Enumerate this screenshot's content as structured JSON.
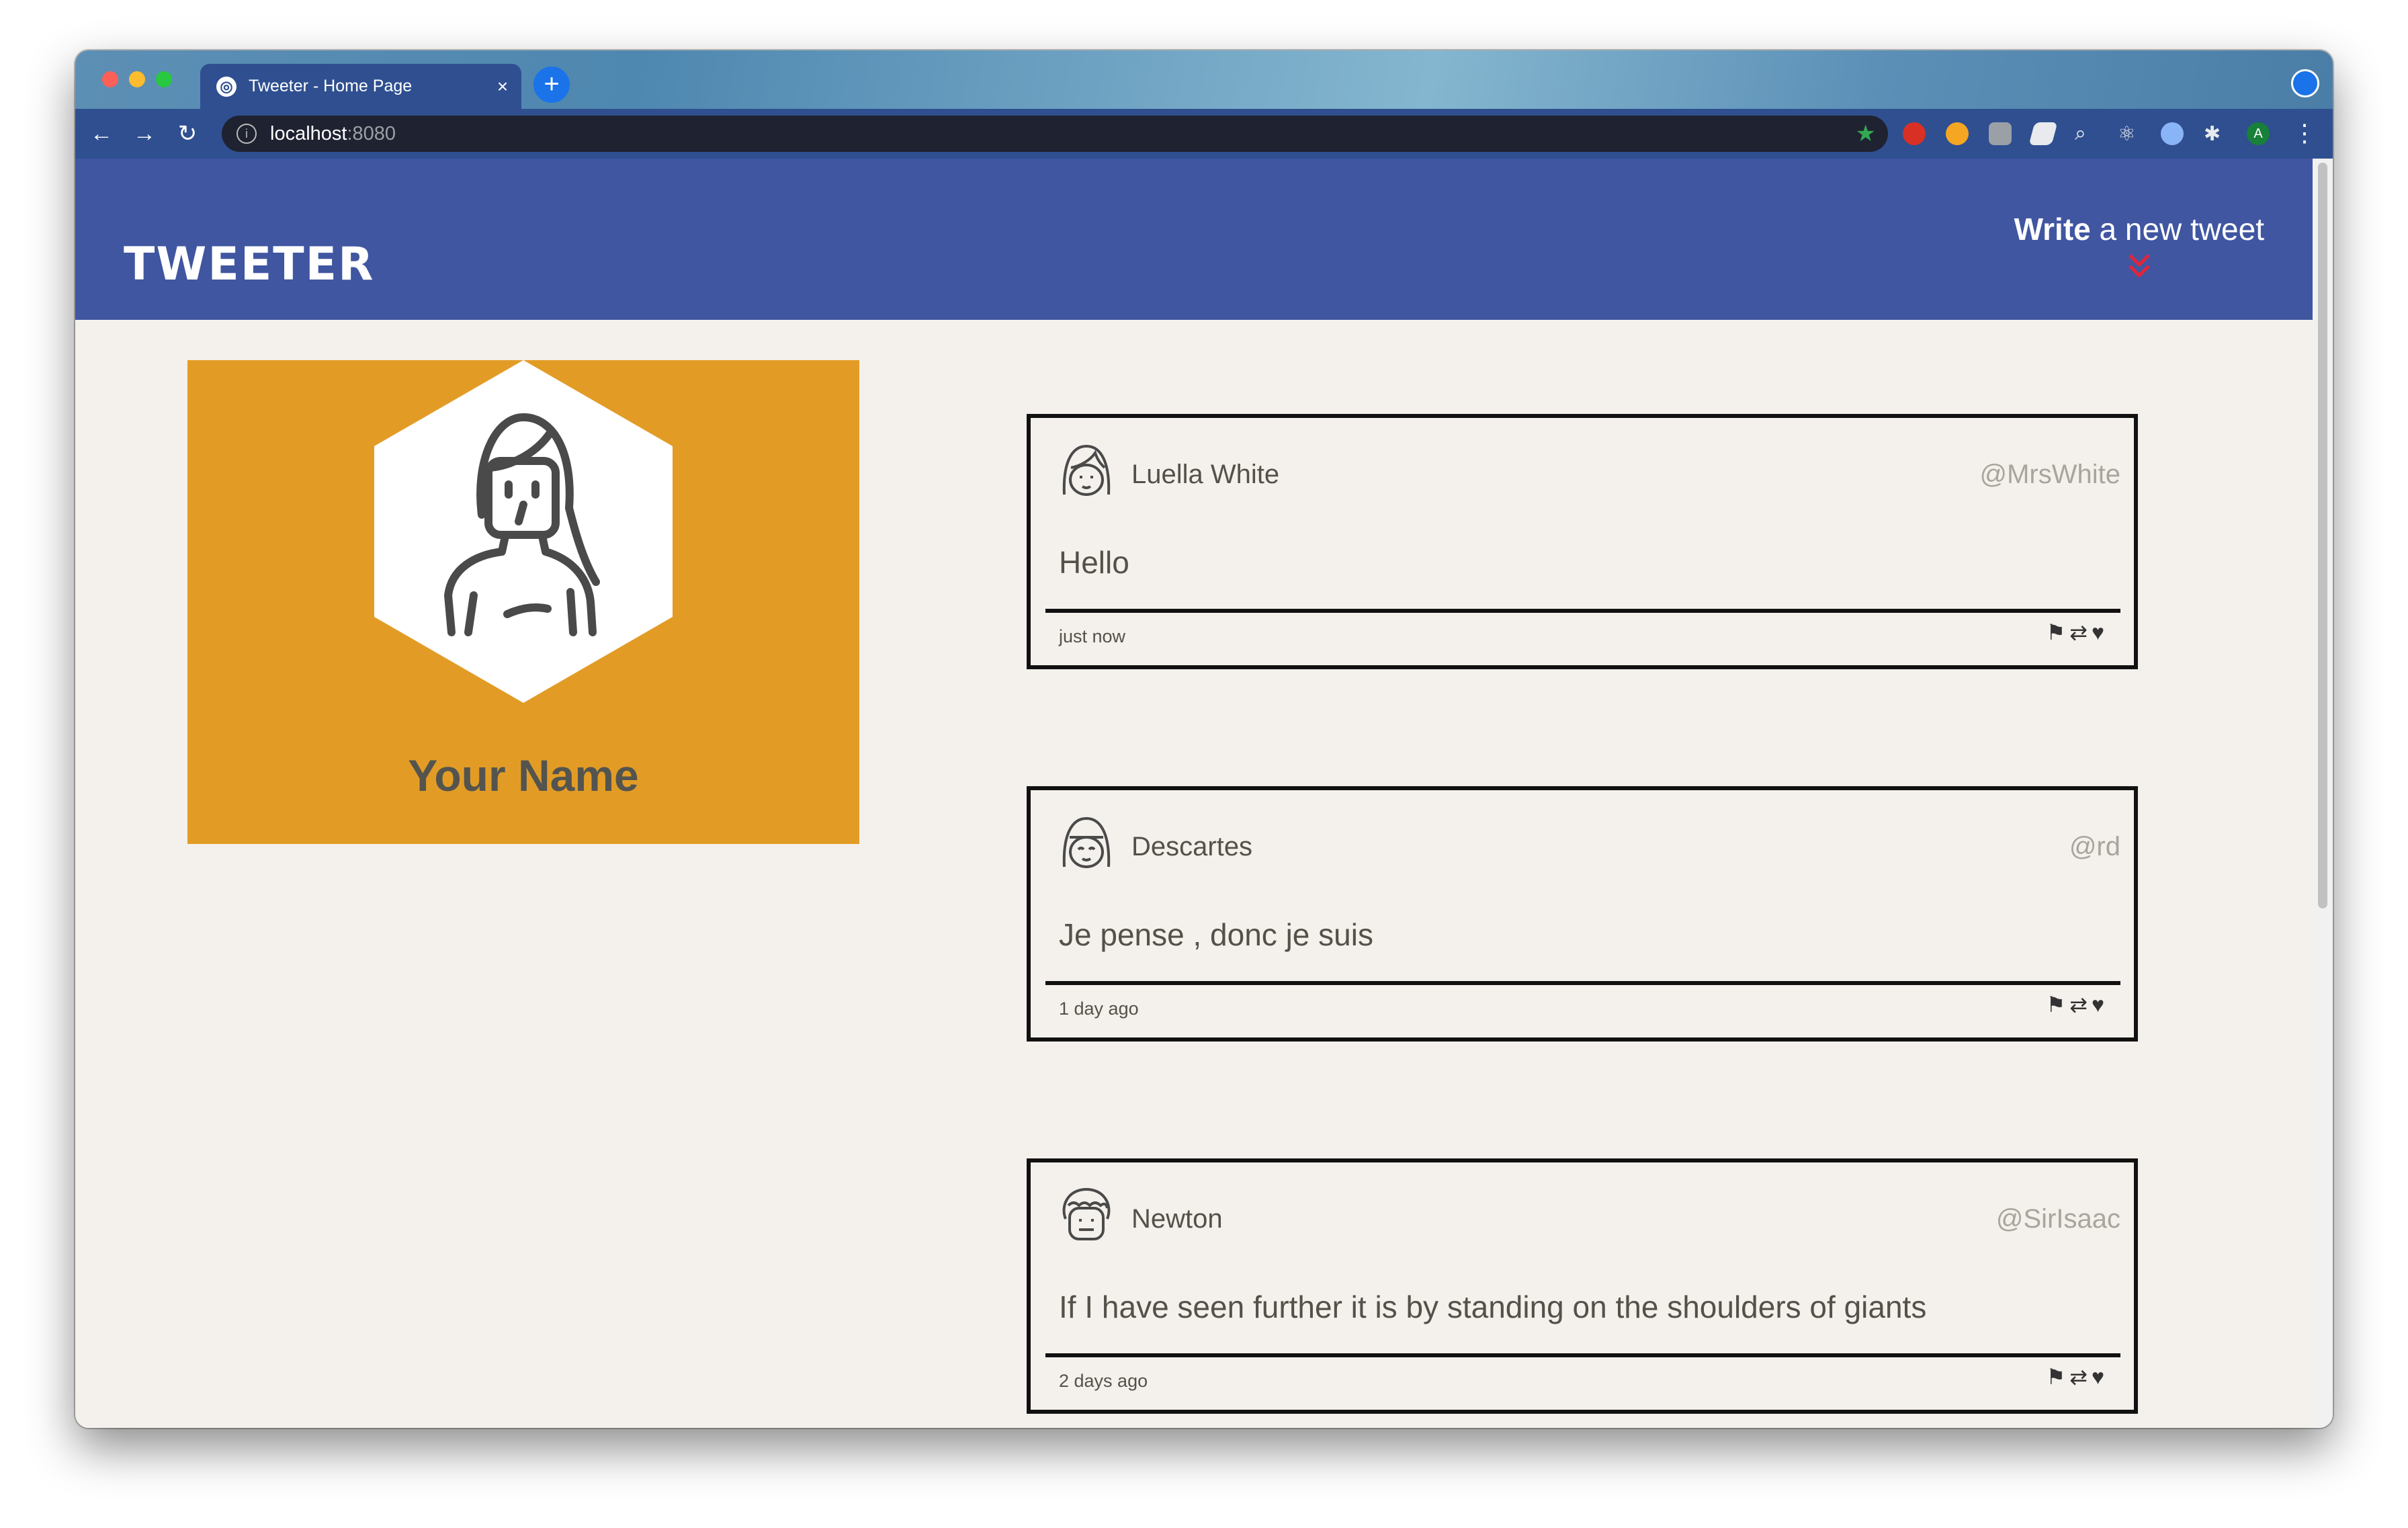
{
  "browser": {
    "tab_title": "Tweeter - Home Page",
    "tab_close": "×",
    "new_tab": "+",
    "url_host": "localhost",
    "url_port": ":8080",
    "icons": [
      "back-icon",
      "forward-icon",
      "reload-icon",
      "info-icon",
      "bookmark-star-icon",
      "extensions-icon",
      "menu-icon"
    ],
    "profile_initial": "A"
  },
  "header": {
    "logo": "TWEETER",
    "compose_bold": "Write",
    "compose_rest": " a new tweet",
    "compose_icon": "»",
    "colors": {
      "nav_bg": "#4056a1",
      "accent": "#e0253b"
    }
  },
  "profile": {
    "name": "Your Name",
    "card_color": "#e29c26"
  },
  "tweets": [
    {
      "name": "Luella White",
      "handle": "@MrsWhite",
      "content": "Hello",
      "time": "just now"
    },
    {
      "name": "Descartes",
      "handle": "@rd",
      "content": "Je pense , donc je suis",
      "time": "1 day ago"
    },
    {
      "name": "Newton",
      "handle": "@SirIsaac",
      "content": "If I have seen further it is by standing on the shoulders of giants",
      "time": "2 days ago"
    }
  ],
  "tweet_actions": [
    "flag-icon",
    "retweet-icon",
    "heart-icon"
  ]
}
